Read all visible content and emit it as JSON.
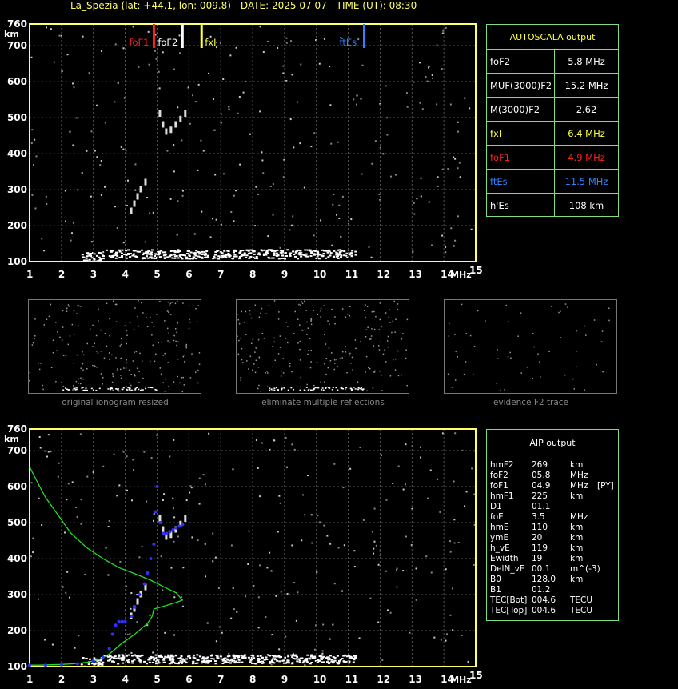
{
  "header": "La_Spezia (lat: +44.1, lon: 009.8) - DATE: 2025 07 07 - TIME (UT): 08:30",
  "colors": {
    "frame": "#ffff66",
    "panel_border": "#7fdc7f",
    "foF1": "#ff2020",
    "foF2": "#ffffff",
    "fxI": "#ffff40",
    "ftEs": "#3080ff",
    "profile": "#20e020",
    "trace": "#3030ff"
  },
  "chart_data": [
    {
      "type": "scatter",
      "name": "ionogram",
      "xlabel": "MHz",
      "ylabel": "km",
      "xlim": [
        1,
        15
      ],
      "ylim": [
        100,
        760
      ],
      "xticks": [
        "1",
        "2",
        "3",
        "4",
        "5",
        "6",
        "7",
        "8",
        "9",
        "10",
        "11",
        "12",
        "13",
        "14",
        "15"
      ],
      "yticks": [
        "100",
        "200",
        "300",
        "400",
        "500",
        "600",
        "700",
        "760"
      ],
      "markers": [
        {
          "label": "foF1",
          "value": 4.9
        },
        {
          "label": "foF2",
          "value": 5.8
        },
        {
          "label": "fxI",
          "value": 6.4
        },
        {
          "label": "ftEs",
          "value": 11.5
        }
      ]
    },
    {
      "type": "line",
      "name": "aip-ionogram",
      "xlabel": "MHz",
      "ylabel": "km",
      "xlim": [
        1,
        15
      ],
      "ylim": [
        100,
        760
      ],
      "xticks": [
        "1",
        "2",
        "3",
        "4",
        "5",
        "6",
        "7",
        "8",
        "9",
        "10",
        "11",
        "12",
        "13",
        "14",
        "15"
      ],
      "yticks": [
        "100",
        "200",
        "300",
        "400",
        "500",
        "600",
        "700",
        "760"
      ],
      "series": [
        {
          "color": "green",
          "x": [
            1.0,
            1.3,
            1.6,
            2.0,
            2.4,
            2.8,
            3.2,
            3.5,
            3.9,
            4.3,
            4.7,
            4.85,
            4.9,
            5.3,
            5.6,
            5.8,
            5.6,
            5.2,
            4.8,
            4.3,
            3.8,
            3.3,
            2.8,
            2.3,
            1.9,
            1.5,
            1.2,
            1.0
          ],
          "y": [
            104,
            104,
            105,
            106,
            108,
            112,
            120,
            135,
            165,
            190,
            220,
            240,
            260,
            270,
            278,
            285,
            305,
            322,
            340,
            358,
            375,
            400,
            430,
            470,
            520,
            570,
            620,
            655
          ]
        },
        {
          "color": "blue",
          "x": [
            1.0,
            1.5,
            2.0,
            2.5,
            3.0,
            3.3,
            3.5,
            3.6,
            3.7,
            3.8,
            3.9,
            4.0,
            4.2,
            4.3,
            4.45,
            4.6,
            4.7,
            4.8,
            4.9,
            4.95,
            5.0,
            5.1,
            5.2,
            5.3,
            5.4,
            5.5,
            5.6,
            5.7,
            5.8
          ],
          "y": [
            104,
            104,
            105,
            108,
            115,
            125,
            150,
            190,
            215,
            225,
            225,
            225,
            240,
            265,
            300,
            330,
            360,
            400,
            440,
            530,
            600,
            500,
            470,
            470,
            475,
            480,
            485,
            490,
            495
          ]
        }
      ]
    }
  ],
  "autoscala": {
    "title": "AUTOSCALA output",
    "rows": [
      {
        "label": "foF2",
        "value": "5.8 MHz",
        "color": "#ffffff"
      },
      {
        "label": "MUF(3000)F2",
        "value": "15.2 MHz",
        "color": "#ffffff"
      },
      {
        "label": "M(3000)F2",
        "value": "2.62",
        "color": "#ffffff"
      },
      {
        "label": "fxI",
        "value": "6.4 MHz",
        "color": "#ffff40"
      },
      {
        "label": "foF1",
        "value": "4.9 MHz",
        "color": "#ff2020"
      },
      {
        "label": "ftEs",
        "value": "11.5 MHz",
        "color": "#3080ff"
      },
      {
        "label": "h'Es",
        "value": "108     km",
        "color": "#ffffff"
      }
    ]
  },
  "aip": {
    "title": "AIP output",
    "rows": [
      [
        "hmF2",
        "269",
        "km",
        ""
      ],
      [
        "foF2",
        "05.8",
        "MHz",
        ""
      ],
      [
        "foF1",
        "04.9",
        "MHz",
        "[PY]"
      ],
      [
        "hmF1",
        "225",
        "km",
        ""
      ],
      [
        "D1",
        "01.1",
        "",
        ""
      ],
      [
        "foE",
        "3.5",
        "MHz",
        ""
      ],
      [
        "hmE",
        "110",
        "km",
        ""
      ],
      [
        "ymE",
        "20",
        "km",
        ""
      ],
      [
        "h_vE",
        "119",
        "km",
        ""
      ],
      [
        "Ewidth",
        "19",
        "km",
        ""
      ],
      [
        "DelN_vE",
        "00.1",
        "m^(-3)",
        ""
      ],
      [
        "B0",
        "128.0",
        "km",
        ""
      ],
      [
        "B1",
        "01.2",
        "",
        ""
      ],
      [
        "TEC[Bot]",
        "004.6",
        "TECU",
        ""
      ],
      [
        "TEC[Top]",
        "004.6",
        "TECU",
        ""
      ]
    ]
  },
  "thumbnails": [
    {
      "caption": "original ionogram resized"
    },
    {
      "caption": "eliminate multiple reflections"
    },
    {
      "caption": "evidence F2 trace"
    }
  ]
}
